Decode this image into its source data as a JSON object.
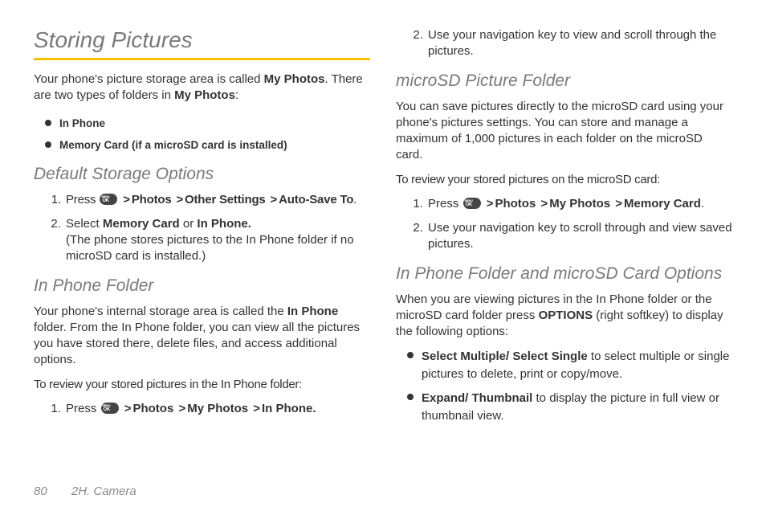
{
  "col1": {
    "title": "Storing Pictures",
    "intro_a": "Your phone's picture storage area is called ",
    "intro_b": "My Photos",
    "intro_c": ". There are two types of folders in ",
    "intro_d": "My Photos",
    "intro_e": ":",
    "bullet1": "In Phone",
    "bullet2": "Memory Card (if a microSD card is installed)",
    "h_default": "Default Storage Options",
    "step1_a": "Press ",
    "step1_b": "Photos",
    "step1_c": "Other Settings",
    "step1_d": "Auto-Save To",
    "step2_a": "Select ",
    "step2_b": "Memory Card",
    "step2_c": " or ",
    "step2_d": "In Phone.",
    "step2_e": "(The phone stores pictures to the In Phone folder if no microSD card is installed.)",
    "h_inphone": "In Phone Folder",
    "ip_para_a": "Your phone's internal storage area is called the ",
    "ip_para_b": "In Phone",
    "ip_para_c": " folder. From the In Phone folder, you can view all the pictures you have stored there, delete files, and access additional options.",
    "ip_review": "To review your stored pictures in the In Phone folder:",
    "ip_step1_a": "Press ",
    "ip_step1_b": "Photos",
    "ip_step1_c": "My Photos",
    "ip_step1_d": "In Phone."
  },
  "col2": {
    "top_step2": "Use your navigation key to view and scroll through the pictures.",
    "h_micro": "microSD Picture  Folder",
    "micro_para": "You can save pictures directly to the microSD card using your phone's pictures settings. You can store and manage a maximum of 1,000 pictures in each folder on the microSD card.",
    "micro_review": "To review your stored pictures on the microSD card:",
    "ms_step1_a": "Press ",
    "ms_step1_b": "Photos",
    "ms_step1_c": "My Photos",
    "ms_step1_d": "Memory Card",
    "ms_step2": "Use your navigation key to scroll through and view saved pictures.",
    "h_both": "In Phone Folder and microSD Card Options",
    "both_para_a": "When you are viewing pictures in the In Phone folder or the microSD card folder press ",
    "both_para_b": "OPTIONS",
    "both_para_c": " (right softkey) to display the following options:",
    "opt1_a": "Select Multiple/ Select Single",
    "opt1_b": " to select multiple or single pictures to delete, print or copy/move.",
    "opt2_a": "Expand/ Thumbnail",
    "opt2_b": " to display the picture in full view or thumbnail view."
  },
  "footer": {
    "page": "80",
    "section": "2H. Camera"
  },
  "gt": ">"
}
